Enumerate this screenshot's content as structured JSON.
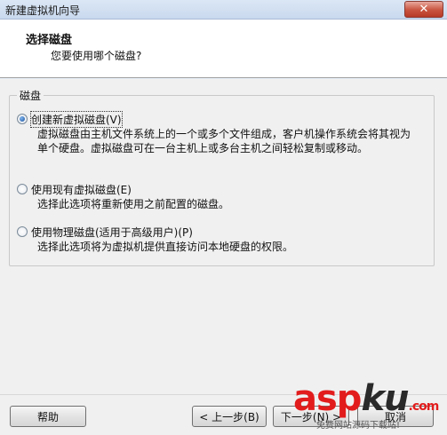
{
  "window": {
    "title": "新建虚拟机向导",
    "close_glyph": "✕"
  },
  "header": {
    "title": "选择磁盘",
    "subtitle": "您要使用哪个磁盘?"
  },
  "group": {
    "legend": "磁盘",
    "options": [
      {
        "label": "创建新虚拟磁盘(V)",
        "desc": "虚拟磁盘由主机文件系统上的一个或多个文件组成，客户机操作系统会将其视为单个硬盘。虚拟磁盘可在一台主机上或多台主机之间轻松复制或移动。",
        "checked": true
      },
      {
        "label": "使用现有虚拟磁盘(E)",
        "desc": "选择此选项将重新使用之前配置的磁盘。",
        "checked": false
      },
      {
        "label": "使用物理磁盘(适用于高级用户)(P)",
        "desc": "选择此选项将为虚拟机提供直接访问本地硬盘的权限。",
        "checked": false
      }
    ]
  },
  "buttons": {
    "help": "帮助",
    "back": "< 上一步(B)",
    "next": "下一步(N) >",
    "cancel": "取消"
  },
  "watermark": {
    "main": "asp",
    "ku": "ku",
    "tld": ".com",
    "sub": "免费网站源码下载站!"
  },
  "colors": {
    "watermark_red": "#e21c1c",
    "selected_radio": "#1b4f9a"
  }
}
